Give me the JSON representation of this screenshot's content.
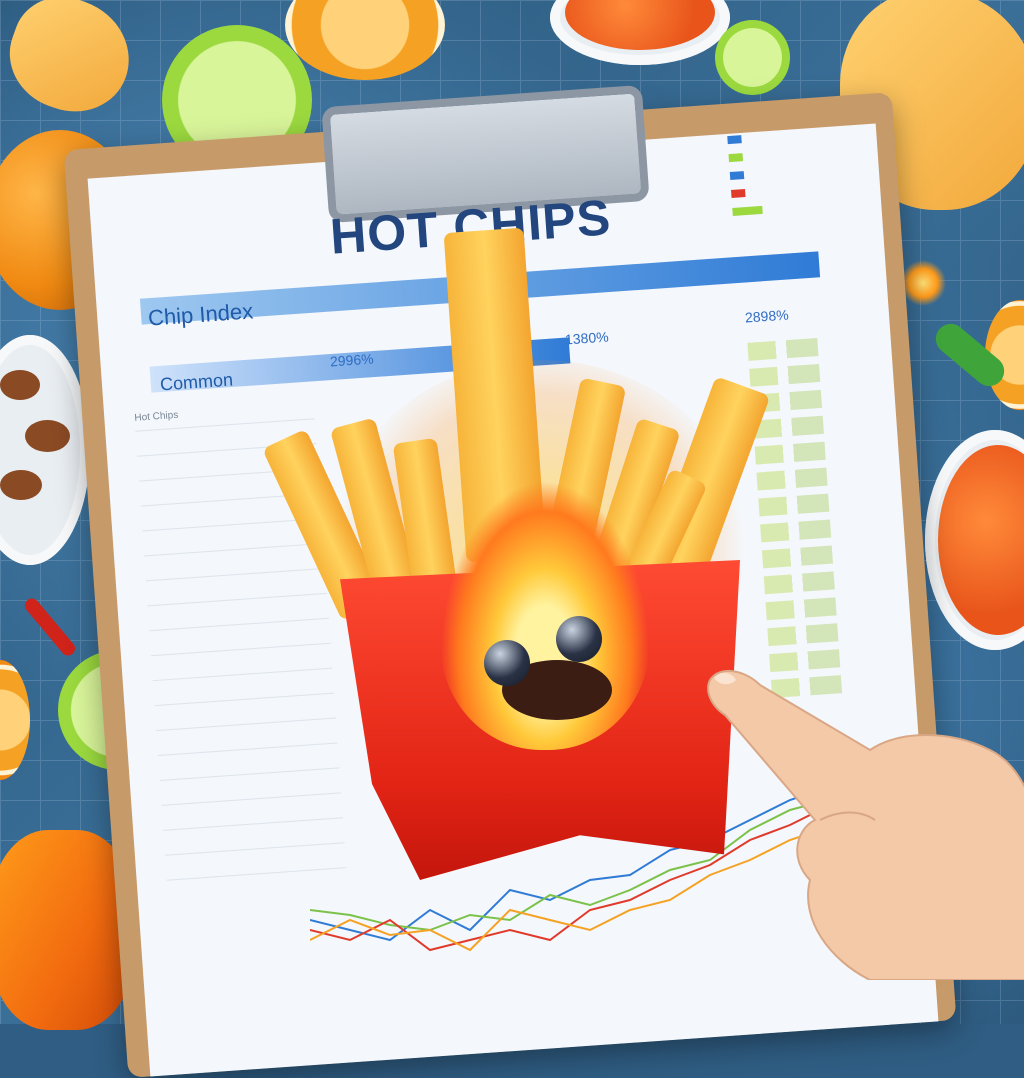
{
  "header": {
    "title": "HOT CHIPS"
  },
  "panels": {
    "index_label": "Chip Index",
    "common_label": "Common"
  },
  "labels": {
    "pct_a": "2996%",
    "pct_b": "1380%",
    "pct_c": "2898%",
    "list_heading": "Hot Chips"
  },
  "colors": {
    "accent_blue": "#2f7bd6",
    "title_navy": "#22467d",
    "fry_gold": "#ffd35e",
    "box_red": "#e22415"
  },
  "icons": {
    "mascot": "flaming-fries-mascot-icon",
    "hand": "pointing-hand-icon"
  }
}
